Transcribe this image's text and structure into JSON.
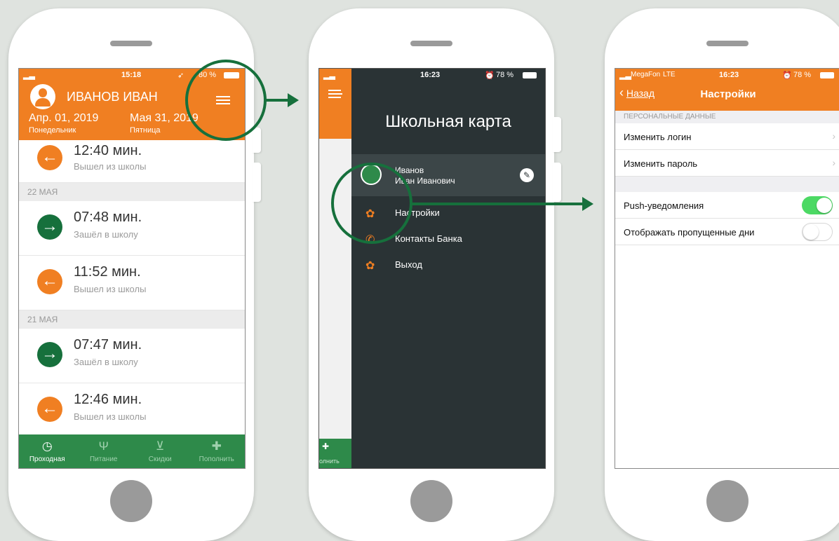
{
  "colors": {
    "background": "#dfe3df",
    "orange": "#f07f22",
    "green": "#2e8a4a",
    "dark_green": "#16703c",
    "drawer": "#2a3335",
    "annotation": "#16703c"
  },
  "phone1": {
    "status": {
      "time": "15:18",
      "battery": "80 %"
    },
    "header": {
      "name": "ИВАНОВ ИВАН",
      "date_from": "Апр. 01, 2019",
      "day_from": "Понедельник",
      "date_to": "Мая 31, 2019",
      "day_to": "Пятница"
    },
    "entries": [
      {
        "time": "12:40 мин.",
        "label": "Вышел из школы",
        "type": "out"
      },
      {
        "date": "22 МАЯ"
      },
      {
        "time": "07:48 мин.",
        "label": "Зашёл в школу",
        "type": "in"
      },
      {
        "time": "11:52 мин.",
        "label": "Вышел из школы",
        "type": "out"
      },
      {
        "date": "21 МАЯ"
      },
      {
        "time": "07:47 мин.",
        "label": "Зашёл в школу",
        "type": "in"
      },
      {
        "time": "12:46 мин.",
        "label": "Вышел из школы",
        "type": "out"
      }
    ],
    "tabs": [
      {
        "label": "Проходная",
        "icon": "clock-icon",
        "glyph": "◷",
        "active": true
      },
      {
        "label": "Питание",
        "icon": "fork-knife-icon",
        "glyph": "Ψ",
        "active": false
      },
      {
        "label": "Скидки",
        "icon": "cart-icon",
        "glyph": "⊻",
        "active": false
      },
      {
        "label": "Пополнить",
        "icon": "location-plus-icon",
        "glyph": "✚",
        "active": false
      }
    ]
  },
  "phone2": {
    "status": {
      "time": "16:23",
      "battery": "78 %"
    },
    "title": "Школьная карта",
    "user": {
      "last_name": "Иванов",
      "first_names": "Иван Иванович"
    },
    "menu": [
      {
        "label": "Настройки",
        "icon": "gear-icon",
        "glyph": "✿"
      },
      {
        "label": "Контакты Банка",
        "icon": "phone-icon",
        "glyph": "✆"
      },
      {
        "label": "Выход",
        "icon": "gear-icon",
        "glyph": "✿"
      }
    ],
    "peek_label": "олнить"
  },
  "phone3": {
    "status": {
      "carrier": "MegaFon",
      "network": "LTE",
      "time": "16:23",
      "battery": "78 %"
    },
    "back_label": "Назад",
    "title": "Настройки",
    "section_personal": "ПЕРСОНАЛЬНЫЕ ДАННЫЕ",
    "rows": [
      {
        "label": "Изменить логин"
      },
      {
        "label": "Изменить пароль"
      }
    ],
    "toggles": [
      {
        "label": "Push-уведомления",
        "on": true
      },
      {
        "label": "Отображать пропущенные дни",
        "on": false
      }
    ]
  }
}
